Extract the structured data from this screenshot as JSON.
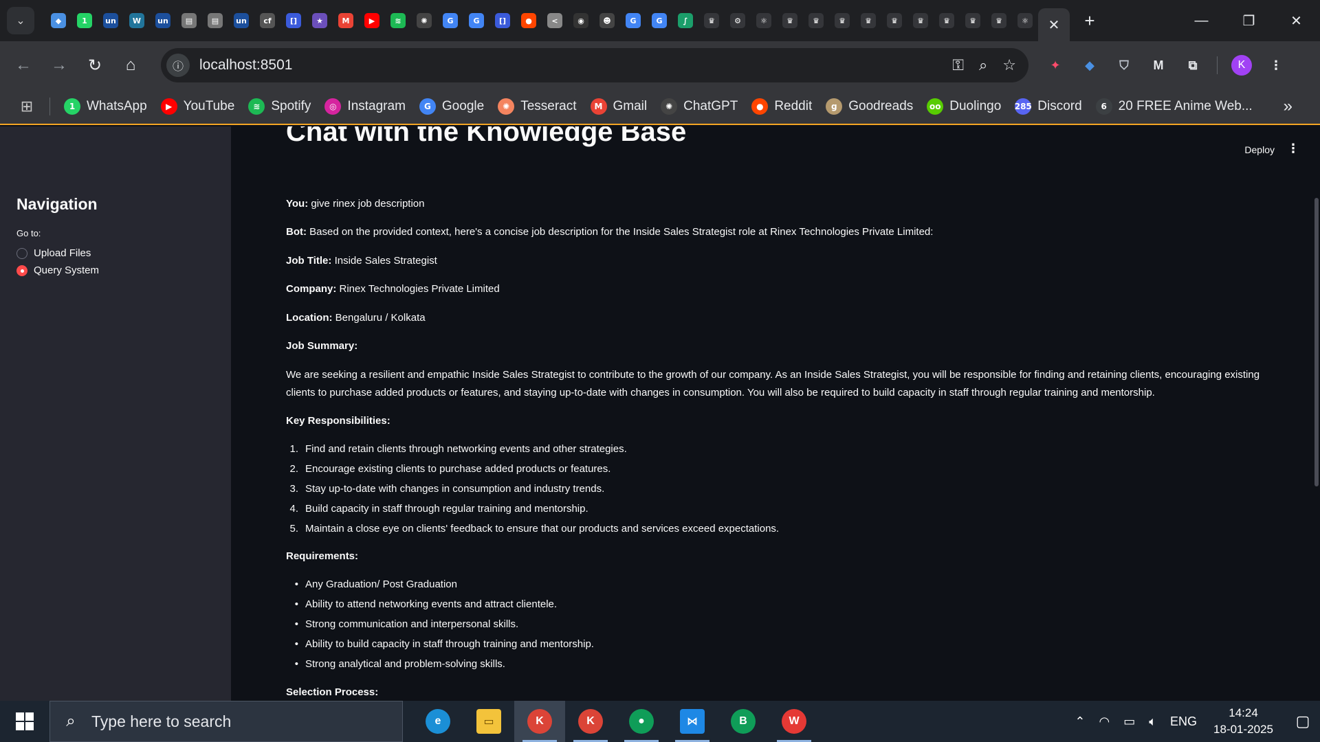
{
  "browser": {
    "url": "localhost:8501",
    "tab_favicons": [
      {
        "name": "gem-favicon",
        "color": "#4a90e2",
        "glyph": "◆"
      },
      {
        "name": "whatsapp-favicon",
        "color": "#25d366",
        "glyph": "1"
      },
      {
        "name": "unstop-favicon",
        "color": "#1c4f9c",
        "glyph": "un"
      },
      {
        "name": "wordpress-favicon",
        "color": "#21759b",
        "glyph": "W"
      },
      {
        "name": "unstop-favicon",
        "color": "#1c4f9c",
        "glyph": "un"
      },
      {
        "name": "doc-favicon",
        "color": "#777",
        "glyph": "▤"
      },
      {
        "name": "doc-favicon",
        "color": "#777",
        "glyph": "▤"
      },
      {
        "name": "unstop-favicon",
        "color": "#1c4f9c",
        "glyph": "un"
      },
      {
        "name": "cfi-favicon",
        "color": "#555",
        "glyph": "cf"
      },
      {
        "name": "bracket-favicon",
        "color": "#3b5bdb",
        "glyph": "[]"
      },
      {
        "name": "star-favicon",
        "color": "#6b4fbb",
        "glyph": "★"
      },
      {
        "name": "gmail-favicon",
        "color": "#ea4335",
        "glyph": "M"
      },
      {
        "name": "youtube-favicon",
        "color": "#ff0000",
        "glyph": "▶"
      },
      {
        "name": "spotify-favicon",
        "color": "#1db954",
        "glyph": "≋"
      },
      {
        "name": "chatgpt-favicon",
        "color": "#444",
        "glyph": "✺"
      },
      {
        "name": "google-favicon",
        "color": "#4285f4",
        "glyph": "G"
      },
      {
        "name": "google-favicon",
        "color": "#4285f4",
        "glyph": "G"
      },
      {
        "name": "bracket-favicon",
        "color": "#3b5bdb",
        "glyph": "[]"
      },
      {
        "name": "reddit-favicon",
        "color": "#ff4500",
        "glyph": "●"
      },
      {
        "name": "share-favicon",
        "color": "#888",
        "glyph": "<"
      },
      {
        "name": "github-favicon",
        "color": "#333",
        "glyph": "◉"
      },
      {
        "name": "bot-favicon",
        "color": "#444",
        "glyph": "☻"
      },
      {
        "name": "google-favicon",
        "color": "#4285f4",
        "glyph": "G"
      },
      {
        "name": "google-favicon",
        "color": "#4285f4",
        "glyph": "G"
      },
      {
        "name": "feather-favicon",
        "color": "#1b9e6a",
        "glyph": "∫"
      },
      {
        "name": "crown-favicon",
        "color": "#35363a",
        "glyph": "♛"
      },
      {
        "name": "gear-favicon",
        "color": "#35363a",
        "glyph": "⚙"
      },
      {
        "name": "react-favicon",
        "color": "#35363a",
        "glyph": "⚛"
      },
      {
        "name": "crown-favicon",
        "color": "#35363a",
        "glyph": "♛"
      },
      {
        "name": "crown-favicon",
        "color": "#35363a",
        "glyph": "♛"
      },
      {
        "name": "crown-favicon",
        "color": "#35363a",
        "glyph": "♛"
      },
      {
        "name": "crown-favicon",
        "color": "#35363a",
        "glyph": "♛"
      },
      {
        "name": "crown-favicon",
        "color": "#35363a",
        "glyph": "♛"
      },
      {
        "name": "crown-favicon",
        "color": "#35363a",
        "glyph": "♛"
      },
      {
        "name": "crown-favicon",
        "color": "#35363a",
        "glyph": "♛"
      },
      {
        "name": "crown-favicon",
        "color": "#35363a",
        "glyph": "♛"
      },
      {
        "name": "crown-favicon",
        "color": "#35363a",
        "glyph": "♛"
      },
      {
        "name": "react-favicon",
        "color": "#35363a",
        "glyph": "⚛"
      }
    ],
    "bookmarks": [
      {
        "label": "WhatsApp",
        "color": "#25d366",
        "glyph": "1"
      },
      {
        "label": "YouTube",
        "color": "#ff0000",
        "glyph": "▶"
      },
      {
        "label": "Spotify",
        "color": "#1db954",
        "glyph": "≋"
      },
      {
        "label": "Instagram",
        "color": "#d6249f",
        "glyph": "◎"
      },
      {
        "label": "Google",
        "color": "#4285f4",
        "glyph": "G"
      },
      {
        "label": "Tesseract",
        "color": "#f4845f",
        "glyph": "✺"
      },
      {
        "label": "Gmail",
        "color": "#ea4335",
        "glyph": "M"
      },
      {
        "label": "ChatGPT",
        "color": "#444444",
        "glyph": "✺"
      },
      {
        "label": "Reddit",
        "color": "#ff4500",
        "glyph": "●"
      },
      {
        "label": "Goodreads",
        "color": "#b59a6e",
        "glyph": "g"
      },
      {
        "label": "Duolingo",
        "color": "#58cc02",
        "glyph": "oo"
      },
      {
        "label": "Discord",
        "color": "#5865f2",
        "glyph": "285"
      },
      {
        "label": "20 FREE Anime Web...",
        "color": "#3c4043",
        "glyph": "6"
      }
    ],
    "avatar_letter": "K"
  },
  "sidebar": {
    "title": "Navigation",
    "goto_label": "Go to:",
    "options": [
      {
        "label": "Upload Files",
        "selected": false
      },
      {
        "label": "Query System",
        "selected": true
      }
    ]
  },
  "header": {
    "deploy_label": "Deploy"
  },
  "chat": {
    "title": "Chat with the Knowledge Base",
    "you_label": "You:",
    "you_text": " give rinex job description",
    "bot_label": "Bot:",
    "bot_text": " Based on the provided context, here's a concise job description for the Inside Sales Strategist role at Rinex Technologies Private Limited:",
    "fields": [
      {
        "label": "Job Title:",
        "value": " Inside Sales Strategist"
      },
      {
        "label": "Company:",
        "value": " Rinex Technologies Private Limited"
      },
      {
        "label": "Location:",
        "value": " Bengaluru / Kolkata"
      }
    ],
    "summary_heading": "Job Summary:",
    "summary_text": "We are seeking a resilient and empathic Inside Sales Strategist to contribute to the growth of our company. As an Inside Sales Strategist, you will be responsible for finding and retaining clients, encouraging existing clients to purchase added products or features, and staying up-to-date with changes in consumption. You will also be required to build capacity in staff through regular training and mentorship.",
    "responsibilities_heading": "Key Responsibilities:",
    "responsibilities": [
      "Find and retain clients through networking events and other strategies.",
      "Encourage existing clients to purchase added products or features.",
      "Stay up-to-date with changes in consumption and industry trends.",
      "Build capacity in staff through regular training and mentorship.",
      "Maintain a close eye on clients' feedback to ensure that our products and services exceed expectations."
    ],
    "requirements_heading": "Requirements:",
    "requirements": [
      "Any Graduation/ Post Graduation",
      "Ability to attend networking events and attract clientele.",
      "Strong communication and interpersonal skills.",
      "Ability to build capacity in staff through training and mentorship.",
      "Strong analytical and problem-solving skills."
    ],
    "selection_heading": "Selection Process:"
  },
  "taskbar": {
    "search_placeholder": "Type here to search",
    "language": "ENG",
    "time": "14:24",
    "date": "18-01-2025"
  }
}
